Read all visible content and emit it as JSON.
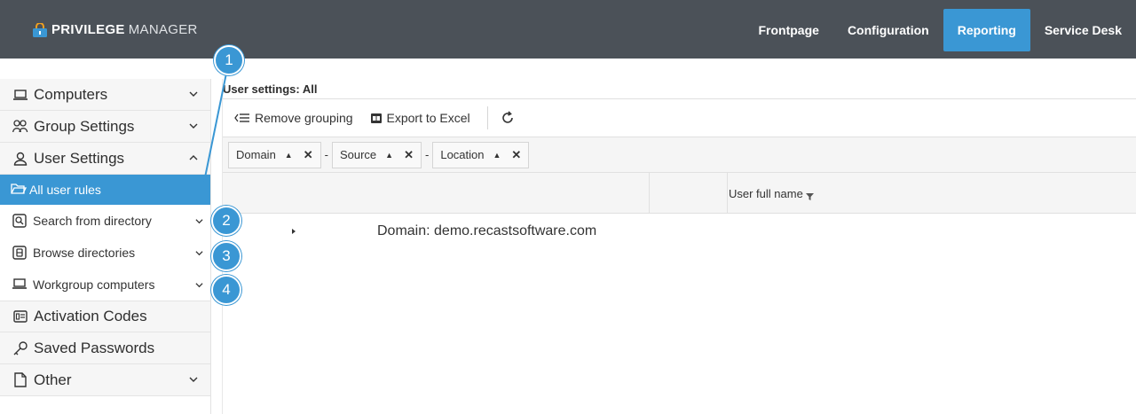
{
  "brand": {
    "name_bold": "PRIVILEGE",
    "name_light": "MANAGER"
  },
  "nav": [
    {
      "label": "Frontpage"
    },
    {
      "label": "Configuration"
    },
    {
      "label": "Reporting",
      "active": true
    },
    {
      "label": "Service Desk"
    }
  ],
  "sidebar": {
    "computers": "Computers",
    "group_settings": "Group Settings",
    "user_settings": "User Settings",
    "all_user_rules": "All user rules",
    "search_from_directory": "Search from directory",
    "browse_directories": "Browse directories",
    "workgroup_computers": "Workgroup computers",
    "activation_codes": "Activation Codes",
    "saved_passwords": "Saved Passwords",
    "other": "Other"
  },
  "content": {
    "title": "User settings: All",
    "toolbar": {
      "remove_grouping": "Remove grouping",
      "export_excel": "Export to Excel"
    },
    "groups": [
      {
        "label": "Domain"
      },
      {
        "label": "Source"
      },
      {
        "label": "Location"
      }
    ],
    "group_separator": "-",
    "columns": {
      "user_full_name": "User full name"
    },
    "group_row": "Domain: demo.recastsoftware.com"
  },
  "callouts": [
    "1",
    "2",
    "3",
    "4"
  ],
  "colors": {
    "topbar": "#4b5158",
    "accent": "#3a97d4"
  }
}
